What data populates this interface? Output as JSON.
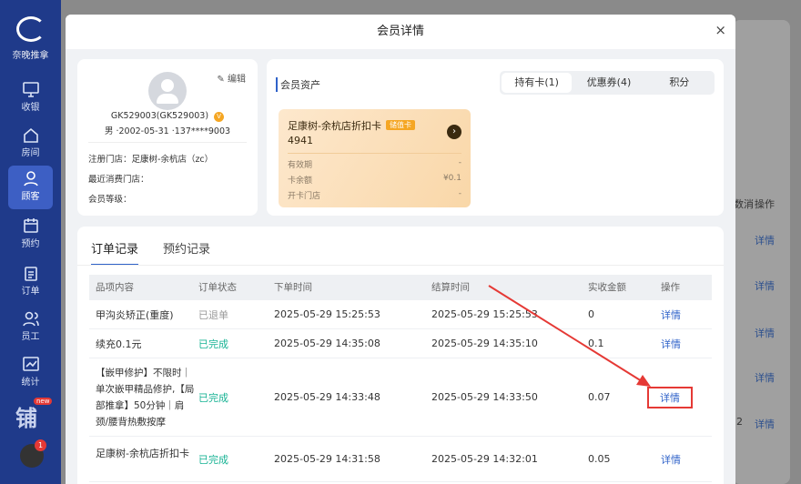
{
  "sidebar": {
    "logo_text": "奈晚推拿",
    "items": [
      {
        "label": "收银",
        "icon": "monitor-icon"
      },
      {
        "label": "房间",
        "icon": "home-icon"
      },
      {
        "label": "顾客",
        "icon": "user-icon"
      },
      {
        "label": "预约",
        "icon": "calendar-icon"
      },
      {
        "label": "订单",
        "icon": "clipboard-icon"
      },
      {
        "label": "员工",
        "icon": "users-icon"
      },
      {
        "label": "统计",
        "icon": "chart-icon"
      }
    ],
    "promo_text": "铺",
    "promo_badge": "new",
    "avatar_badge": "1"
  },
  "background": {
    "col_headers": [
      "数消",
      "操作"
    ],
    "detail_label": "详情",
    "page_num": "2"
  },
  "modal": {
    "title": "会员详情",
    "close": "×"
  },
  "profile": {
    "edit_label": "编辑",
    "id": "GK529003(GK529003)",
    "vip_badge": "V",
    "info": "男 ·2002-05-31 ·137****9003",
    "store_label": "注册门店：",
    "store_value": "足康树-余杭店（zc）",
    "recent_label": "最近消费门店：",
    "level_label": "会员等级："
  },
  "assets": {
    "title": "会员资产",
    "tabs": [
      "持有卡(1)",
      "优惠券(4)",
      "积分"
    ],
    "card": {
      "name": "足康树-余杭店折扣卡",
      "type_badge": "储值卡",
      "number": "4941",
      "rows": [
        {
          "label": "有效期",
          "value": "-"
        },
        {
          "label": "卡余额",
          "value": "¥0.1"
        },
        {
          "label": "开卡门店",
          "value": "-"
        }
      ]
    }
  },
  "records": {
    "tabs": [
      "订单记录",
      "预约记录"
    ],
    "headers": [
      "品项内容",
      "订单状态",
      "下单时间",
      "结算时间",
      "实收金额",
      "操作"
    ],
    "rows": [
      {
        "item": "甲沟炎矫正(重度)",
        "status": "已退单",
        "order_time": "2025-05-29 15:25:53",
        "settle_time": "2025-05-29 15:25:53",
        "amount": "0",
        "action": "详情"
      },
      {
        "item": "续充0.1元",
        "status": "已完成",
        "order_time": "2025-05-29 14:35:08",
        "settle_time": "2025-05-29 14:35:10",
        "amount": "0.1",
        "action": "详情"
      },
      {
        "item": "【嵌甲修护】不限时｜单次嵌甲精品修护,【局部推拿】50分钟｜肩颈/腰背热敷按摩",
        "status": "已完成",
        "order_time": "2025-05-29 14:33:48",
        "settle_time": "2025-05-29 14:33:50",
        "amount": "0.07",
        "action": "详情"
      },
      {
        "item": "足康树-余杭店折扣卡",
        "status": "已完成",
        "order_time": "2025-05-29 14:31:58",
        "settle_time": "2025-05-29 14:32:01",
        "amount": "0.05",
        "action": "详情"
      }
    ]
  },
  "colors": {
    "sidebar": "#1f3a8a",
    "accent_link": "#2f62c9",
    "done_status": "#18b394",
    "cancel_status": "#999999",
    "highlight": "#e53935"
  }
}
